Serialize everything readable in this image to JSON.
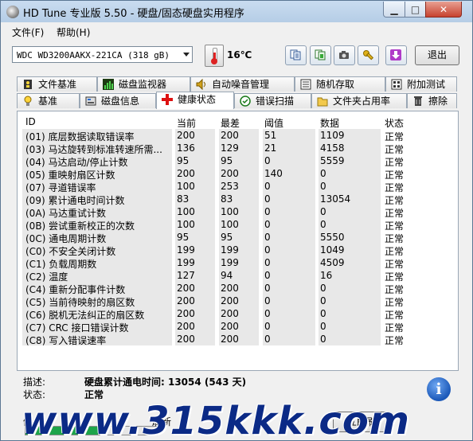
{
  "window": {
    "title": "HD Tune 专业版 5.50 - 硬盘/固态硬盘实用程序"
  },
  "menu": {
    "file": "文件(F)",
    "help": "帮助(H)"
  },
  "toolbar": {
    "drive": "WDC WD3200AAKX-221CA (318 gB)",
    "temperature": "16℃",
    "exit_label": "退出",
    "buttons": [
      "copy-text-icon",
      "copy-info-icon",
      "screenshot-camera-icon",
      "options-tools-icon",
      "save-download-icon"
    ]
  },
  "tabs_top": [
    "文件基准",
    "磁盘监视器",
    "自动噪音管理",
    "随机存取",
    "附加测试"
  ],
  "tabs_bottom": [
    "基准",
    "磁盘信息",
    "健康状态",
    "错误扫描",
    "文件夹占用率",
    "擦除"
  ],
  "active_tab": "健康状态",
  "table": {
    "headers": {
      "id": "ID",
      "current": "当前",
      "worst": "最差",
      "threshold": "阈值",
      "data": "数据",
      "status": "状态"
    },
    "rows": [
      {
        "id": "(01) 底层数据读取错误率",
        "current": "200",
        "worst": "200",
        "threshold": "51",
        "data": "1109",
        "status": "正常"
      },
      {
        "id": "(03) 马达旋转到标准转速所需...",
        "current": "136",
        "worst": "129",
        "threshold": "21",
        "data": "4158",
        "status": "正常"
      },
      {
        "id": "(04) 马达启动/停止计数",
        "current": "95",
        "worst": "95",
        "threshold": "0",
        "data": "5559",
        "status": "正常"
      },
      {
        "id": "(05) 重映射扇区计数",
        "current": "200",
        "worst": "200",
        "threshold": "140",
        "data": "0",
        "status": "正常"
      },
      {
        "id": "(07) 寻道错误率",
        "current": "100",
        "worst": "253",
        "threshold": "0",
        "data": "0",
        "status": "正常"
      },
      {
        "id": "(09) 累计通电时间计数",
        "current": "83",
        "worst": "83",
        "threshold": "0",
        "data": "13054",
        "status": "正常"
      },
      {
        "id": "(0A) 马达重试计数",
        "current": "100",
        "worst": "100",
        "threshold": "0",
        "data": "0",
        "status": "正常"
      },
      {
        "id": "(0B) 尝试重新校正的次数",
        "current": "100",
        "worst": "100",
        "threshold": "0",
        "data": "0",
        "status": "正常"
      },
      {
        "id": "(0C) 通电周期计数",
        "current": "95",
        "worst": "95",
        "threshold": "0",
        "data": "5550",
        "status": "正常"
      },
      {
        "id": "(C0) 不安全关闭计数",
        "current": "199",
        "worst": "199",
        "threshold": "0",
        "data": "1049",
        "status": "正常"
      },
      {
        "id": "(C1) 负载周期数",
        "current": "199",
        "worst": "199",
        "threshold": "0",
        "data": "4509",
        "status": "正常"
      },
      {
        "id": "(C2) 温度",
        "current": "127",
        "worst": "94",
        "threshold": "0",
        "data": "16",
        "status": "正常"
      },
      {
        "id": "(C4) 重新分配事件计数",
        "current": "200",
        "worst": "200",
        "threshold": "0",
        "data": "0",
        "status": "正常"
      },
      {
        "id": "(C5) 当前待映射的扇区数",
        "current": "200",
        "worst": "200",
        "threshold": "0",
        "data": "0",
        "status": "正常"
      },
      {
        "id": "(C6) 脱机无法纠正的扇区数",
        "current": "200",
        "worst": "200",
        "threshold": "0",
        "data": "0",
        "status": "正常"
      },
      {
        "id": "(C7) CRC 接口错误计数",
        "current": "200",
        "worst": "200",
        "threshold": "0",
        "data": "0",
        "status": "正常"
      },
      {
        "id": "(C8) 写入错误速率",
        "current": "200",
        "worst": "200",
        "threshold": "0",
        "data": "0",
        "status": "正常"
      }
    ]
  },
  "info": {
    "desc_label": "描述:",
    "desc_value": "硬盘累计通电时间: 13054 (543 天)",
    "status_label": "状态:",
    "status_value": "正常"
  },
  "bottom": {
    "health_label": "健",
    "refresh_label": "刷新",
    "refresh_now_label": "立即刷",
    "progress_fraction": 0.55
  },
  "watermark": "www.315kkk.com",
  "colors": {
    "progress": "#1ea44a",
    "accent": "#1b58b8"
  }
}
